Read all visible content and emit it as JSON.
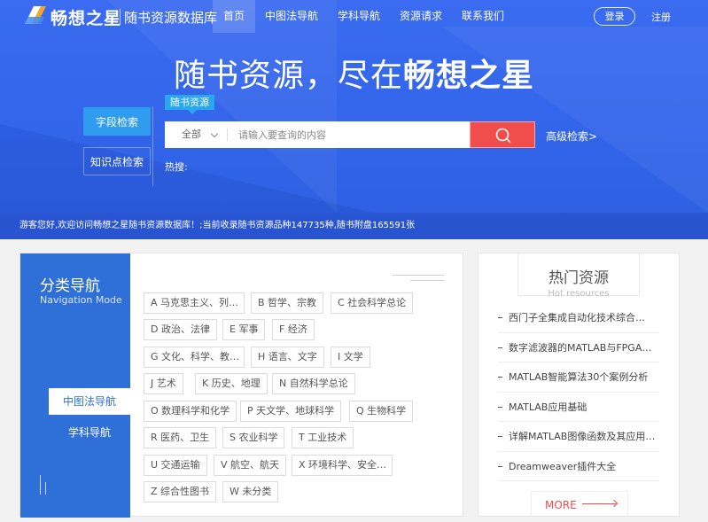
{
  "header": {
    "brand": "畅想之星",
    "subbrand": "随书资源数据库",
    "nav": [
      "首页",
      "中图法导航",
      "学科导航",
      "资源请求",
      "联系我们"
    ],
    "login": "登录",
    "register": "注册"
  },
  "hero": {
    "slogan_prefix": "随书资源，尽在",
    "slogan_bold": "畅想之星",
    "tabs": [
      "字段检索",
      "知识点检索"
    ],
    "scope_tag": "随书资源",
    "search": {
      "select": "全部",
      "placeholder": "请输入要查询的内容",
      "advanced": "高级检索>"
    },
    "hot_words_label": "热搜:",
    "welcome": "游客您好,欢迎访问畅想之星随书资源数据库！;当前收录随书资源品种147735种,随书附盘165591张"
  },
  "category_nav": {
    "title": "分类导航",
    "subtitle": "Navigation Mode",
    "tabs": [
      "中图法导航",
      "学科导航"
    ],
    "categories": [
      "A 马克思主义、列…",
      "B 哲学、宗教",
      "C 社会科学总论",
      "D 政治、法律",
      "E 军事",
      "F 经济",
      "G 文化、科学、教…",
      "H 语言、文字",
      "I 文学",
      "J 艺术",
      "K 历史、地理",
      "N 自然科学总论",
      "O 数理科学和化学",
      "P 天文学、地球科学",
      "Q 生物科学",
      "R 医药、卫生",
      "S 农业科学",
      "T 工业技术",
      "U 交通运输",
      "V 航空、航天",
      "X 环境科学、安全…",
      "Z 综合性图书",
      "W 未分类"
    ]
  },
  "hot_resources": {
    "title": "热门资源",
    "subtitle": "Hot resources",
    "items": [
      "西门子全集成自动化技术综合…",
      "数字滤波器的MATLAB与FPGA实现",
      "MATLAB智能算法30个案例分析",
      "MATLAB应用基础",
      "详解MATLAB图像函数及其应用（…",
      "Dreamweaver插件大全"
    ],
    "more": "MORE"
  },
  "colors": {
    "hero_blue": "#3265ea",
    "panel_blue": "#2f6fd8",
    "search_red": "#f14d4d",
    "tag_blue": "#2ba7ee"
  }
}
